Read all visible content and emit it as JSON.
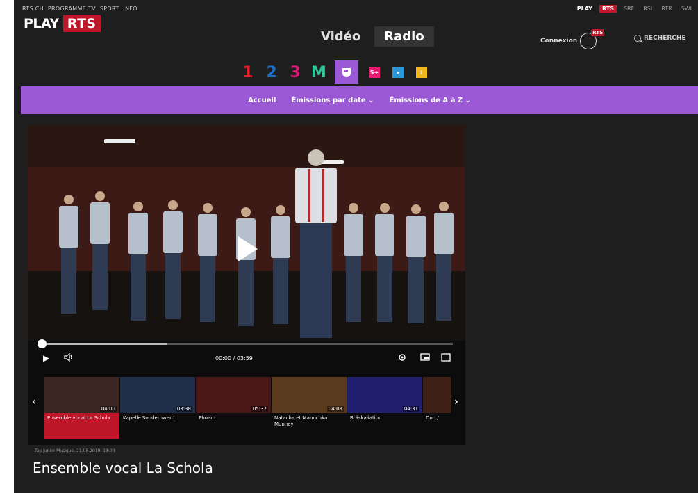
{
  "header": {
    "top_links": [
      "RTS.CH",
      "PROGRAMME TV",
      "SPORT",
      "INFO"
    ],
    "brand_links": [
      "PLAY",
      "RTS",
      "SRF",
      "RSI",
      "RTR",
      "SWI"
    ],
    "logo_play": "PLAY",
    "logo_rts": "RTS",
    "media_tabs": [
      "Vidéo",
      "Radio"
    ],
    "active_media_tab": "Radio",
    "connexion": "Connexion",
    "user_badge": "RTS",
    "search": "RECHERCHE"
  },
  "channels": [
    {
      "label": "1",
      "color": "#e4202a"
    },
    {
      "label": "2",
      "color": "#1e6fc7"
    },
    {
      "label": "3",
      "color": "#e11a7a"
    },
    {
      "label": "M",
      "color": "#2ec89a"
    },
    {
      "label": "",
      "color": "#ffffff",
      "active": true
    },
    {
      "label": "",
      "color": "#e8176f"
    },
    {
      "label": "",
      "color": "#2a97d8"
    },
    {
      "label": "",
      "color": "#f2b61c"
    }
  ],
  "subnav": [
    "Accueil",
    "Émissions par date ⌄",
    "Émissions de A à Z ⌄"
  ],
  "player": {
    "time": "00:00 / 03:59",
    "playlist": [
      {
        "title": "Ensemble vocal La Schola",
        "duration": "04:00",
        "active": true
      },
      {
        "title": "Kapelle Sondernwerd",
        "duration": "03:38"
      },
      {
        "title": "Phoam",
        "duration": "05:32"
      },
      {
        "title": "Natacha et Manuchka Monney",
        "duration": "04:03"
      },
      {
        "title": "Bräskaliation",
        "duration": "04:31"
      },
      {
        "title": "Duo /",
        "duration": ""
      }
    ]
  },
  "video_meta": "Tap Junior Musique, 21.05.2019, 13:00",
  "video_title": "Ensemble vocal La Schola",
  "colors": {
    "accent": "#9b59d6",
    "brand": "#c0162a",
    "bg": "#1e1e1e"
  }
}
